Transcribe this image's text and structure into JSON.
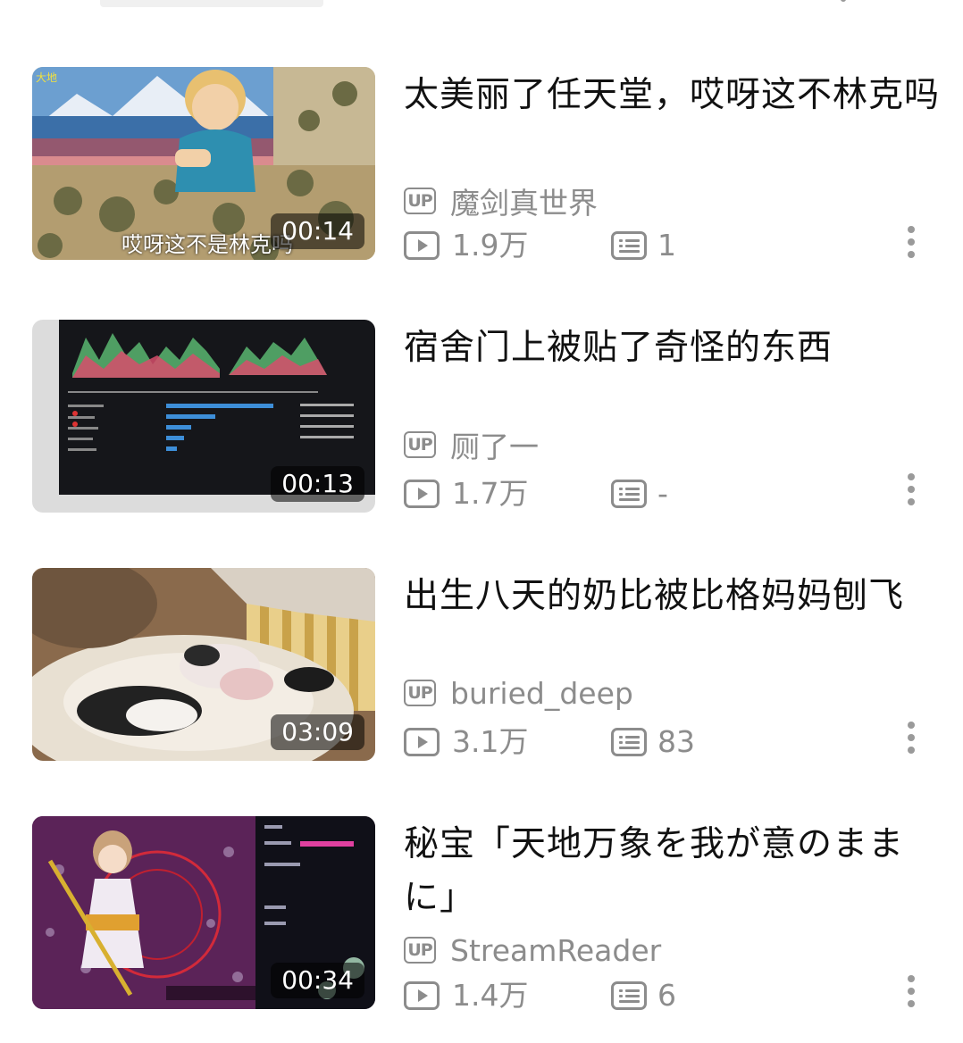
{
  "videos": [
    {
      "title": "太美丽了任天堂，哎呀这不林克吗",
      "uploader": "魔剑真世界",
      "views": "1.9万",
      "danmaku": "1",
      "duration": "00:14",
      "thumb_caption": "哎呀这不是林克吗"
    },
    {
      "title": "宿舍门上被贴了奇怪的东西",
      "uploader": "厕了一",
      "views": "1.7万",
      "danmaku": "-",
      "duration": "00:13"
    },
    {
      "title": "出生八天的奶比被比格妈妈刨飞",
      "uploader": "buried_deep",
      "views": "3.1万",
      "danmaku": "83",
      "duration": "03:09"
    },
    {
      "title": "秘宝「天地万象を我が意のままに」",
      "uploader": "StreamReader",
      "views": "1.4万",
      "danmaku": "6",
      "duration": "00:34"
    }
  ],
  "labels": {
    "up_badge": "UP"
  },
  "icons": {
    "views": "play-icon",
    "danmaku": "danmaku-icon",
    "more": "more-vertical-icon"
  }
}
